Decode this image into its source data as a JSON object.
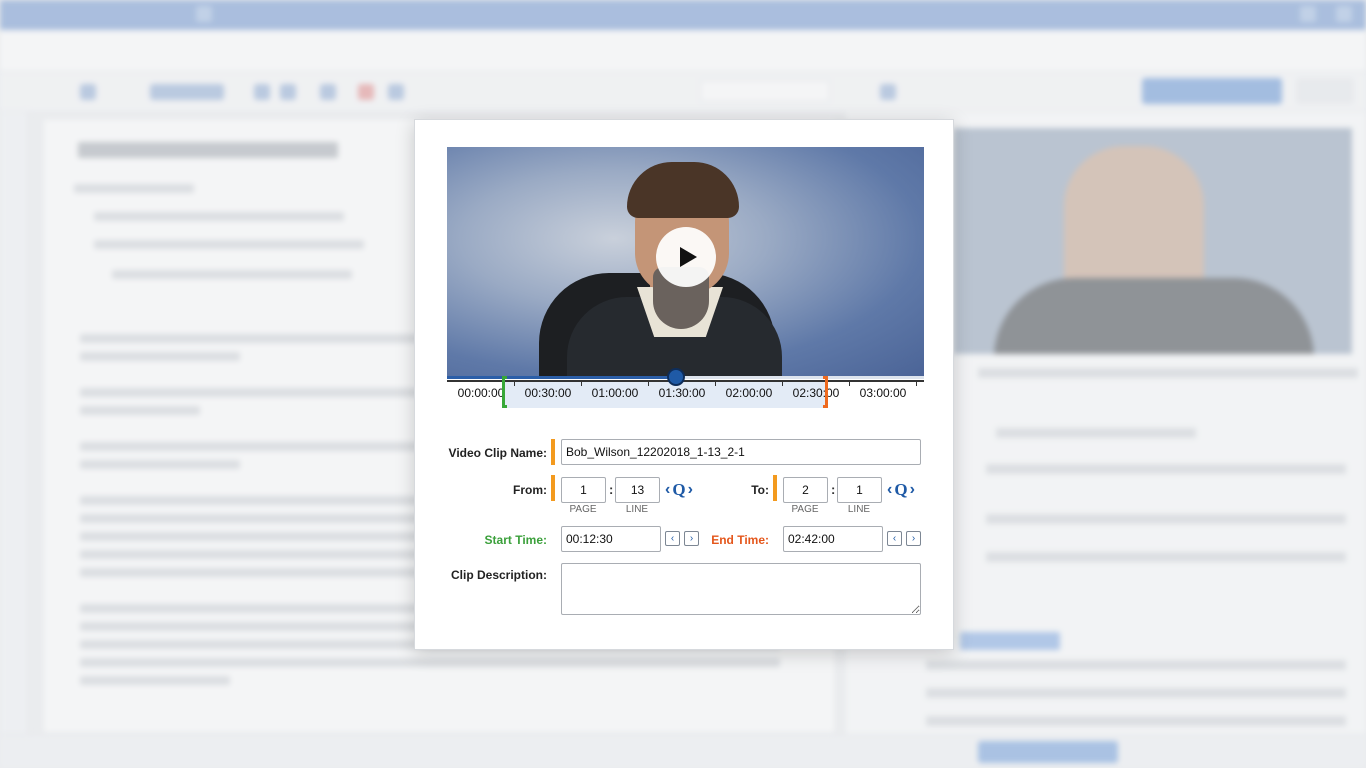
{
  "background": {
    "window_title": "",
    "tabs": [
      "",
      "",
      "",
      "",
      "",
      "",
      ""
    ],
    "search_placeholder": ""
  },
  "video": {
    "play_label": "Play",
    "progress_fraction": 0.48,
    "timeline_labels": [
      "00:00:00",
      "00:30:00",
      "01:00:00",
      "01:30:00",
      "02:00:00",
      "02:30:00",
      "03:00:00"
    ],
    "clip_start_fraction": 0.12,
    "clip_end_fraction": 0.795
  },
  "form": {
    "clip_name_label": "Video Clip Name:",
    "clip_name_value": "Bob_Wilson_12202018_1-13_2-1",
    "from_label": "From:",
    "from_page": "1",
    "from_line": "13",
    "to_label": "To:",
    "to_page": "2",
    "to_line": "1",
    "page_sublabel": "PAGE",
    "line_sublabel": "LINE",
    "colon": ":",
    "q_icon_text": "Q",
    "prev_glyph": "‹",
    "next_glyph": "›",
    "start_time_label": "Start Time:",
    "start_time_value": "00:12:30",
    "end_time_label": "End Time:",
    "end_time_value": "02:42:00",
    "description_label": "Clip Description:",
    "description_value": ""
  },
  "colors": {
    "accent": "#1f5aa6",
    "required_marker": "#f39a1e",
    "start_green": "#3ba03b",
    "end_orange": "#e4561b"
  }
}
